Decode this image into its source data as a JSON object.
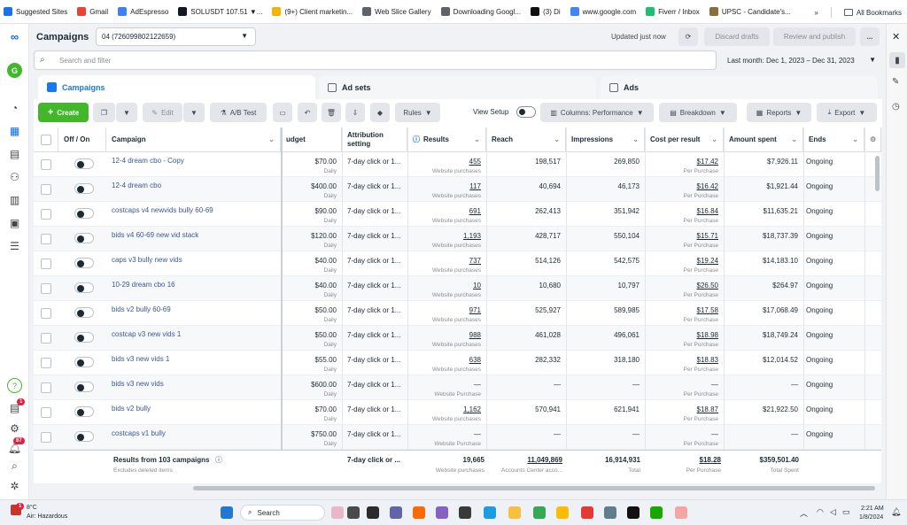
{
  "bookmarks": [
    {
      "label": "Suggested Sites",
      "icon": "ie-icon",
      "color": "#1a73e8"
    },
    {
      "label": "Gmail",
      "icon": "gmail-icon",
      "color": "#ea4335"
    },
    {
      "label": "AdEspresso",
      "icon": "adespresso-icon",
      "color": "#3b82f6"
    },
    {
      "label": "SOLUSDT 107.51 ▼...",
      "icon": "tradingview-icon",
      "color": "#131722"
    },
    {
      "label": "(9+) Client marketin...",
      "icon": "upwork-icon",
      "color": "#f4b400"
    },
    {
      "label": "Web Slice Gallery",
      "icon": "globe-icon",
      "color": "#5f6368"
    },
    {
      "label": "Downloading Googl...",
      "icon": "doc-icon",
      "color": "#5f6368"
    },
    {
      "label": "(3) Di",
      "icon": "fiverr-icon",
      "color": "#111111"
    },
    {
      "label": "www.google.com",
      "icon": "google-icon",
      "color": "#4285f4"
    },
    {
      "label": "Fiverr / Inbox",
      "icon": "fiverr-icon",
      "color": "#1dbf73"
    },
    {
      "label": "UPSC - Candidate's...",
      "icon": "upsc-icon",
      "color": "#8a6d3b"
    }
  ],
  "all_bookmarks": "All Bookmarks",
  "header": {
    "title": "Campaigns",
    "account": "04 (726099802122659)",
    "updated": "Updated just now",
    "discard": "Discard drafts",
    "review": "Review and publish",
    "more": "..."
  },
  "search": {
    "placeholder": "Search and filter"
  },
  "date_range": "Last month: Dec 1, 2023 – Dec 31, 2023",
  "tabs": {
    "campaigns": "Campaigns",
    "adsets": "Ad sets",
    "ads": "Ads"
  },
  "toolbar": {
    "create": "Create",
    "edit": "Edit",
    "ab_test": "A/B Test",
    "rules": "Rules",
    "view_setup": "View Setup",
    "columns": "Columns: Performance",
    "breakdown": "Breakdown",
    "reports": "Reports",
    "export": "Export"
  },
  "columns": {
    "offon": "Off / On",
    "campaign": "Campaign",
    "budget": "udget",
    "attribution": "Attribution setting",
    "results": "Results",
    "reach": "Reach",
    "impressions": "Impressions",
    "cpr": "Cost per result",
    "spent": "Amount spent",
    "ends": "Ends"
  },
  "rows": [
    {
      "name": "12-4 dream cbo - Copy",
      "budget": "$70.00",
      "budget_sub": "Daily",
      "attr": "7-day click or 1...",
      "results": "455",
      "results_sub": "Website purchases",
      "reach": "198,517",
      "impr": "269,850",
      "cpr": "$17.42",
      "cpr_sub": "Per Purchase",
      "spent": "$7,926.11",
      "ends": "Ongoing"
    },
    {
      "name": "12-4 dream cbo",
      "budget": "$400.00",
      "budget_sub": "Daily",
      "attr": "7-day click or 1...",
      "results": "117",
      "results_sub": "Website purchases",
      "reach": "40,694",
      "impr": "46,173",
      "cpr": "$16.42",
      "cpr_sub": "Per Purchase",
      "spent": "$1,921.44",
      "ends": "Ongoing"
    },
    {
      "name": "costcaps v4 newvids bully 60-69",
      "budget": "$90.00",
      "budget_sub": "Daily",
      "attr": "7-day click or 1...",
      "results": "691",
      "results_sub": "Website purchases",
      "reach": "262,413",
      "impr": "351,942",
      "cpr": "$16.84",
      "cpr_sub": "Per Purchase",
      "spent": "$11,635.21",
      "ends": "Ongoing"
    },
    {
      "name": "bids v4 60-69 new vid stack",
      "budget": "$120.00",
      "budget_sub": "Daily",
      "attr": "7-day click or 1...",
      "results": "1,193",
      "results_sub": "Website purchases",
      "reach": "428,717",
      "impr": "550,104",
      "cpr": "$15.71",
      "cpr_sub": "Per Purchase",
      "spent": "$18,737.39",
      "ends": "Ongoing"
    },
    {
      "name": "caps v3 bully new vids",
      "budget": "$40.00",
      "budget_sub": "Daily",
      "attr": "7-day click or 1...",
      "results": "737",
      "results_sub": "Website purchases",
      "reach": "514,126",
      "impr": "542,575",
      "cpr": "$19.24",
      "cpr_sub": "Per Purchase",
      "spent": "$14,183.10",
      "ends": "Ongoing"
    },
    {
      "name": "10-29 dream cbo 16",
      "budget": "$40.00",
      "budget_sub": "Daily",
      "attr": "7-day click or 1...",
      "results": "10",
      "results_sub": "Website purchases",
      "reach": "10,680",
      "impr": "10,797",
      "cpr": "$26.50",
      "cpr_sub": "Per Purchase",
      "spent": "$264.97",
      "ends": "Ongoing"
    },
    {
      "name": "bids v2 bully 60-69",
      "budget": "$50.00",
      "budget_sub": "Daily",
      "attr": "7-day click or 1...",
      "results": "971",
      "results_sub": "Website purchases",
      "reach": "525,927",
      "impr": "589,985",
      "cpr": "$17.58",
      "cpr_sub": "Per Purchase",
      "spent": "$17,068.49",
      "ends": "Ongoing"
    },
    {
      "name": "costcap v3 new vids 1",
      "budget": "$50.00",
      "budget_sub": "Daily",
      "attr": "7-day click or 1...",
      "results": "988",
      "results_sub": "Website purchases",
      "reach": "461,028",
      "impr": "496,061",
      "cpr": "$18.98",
      "cpr_sub": "Per Purchase",
      "spent": "$18,749.24",
      "ends": "Ongoing"
    },
    {
      "name": "bids v3 new vids 1",
      "budget": "$55.00",
      "budget_sub": "Daily",
      "attr": "7-day click or 1...",
      "results": "638",
      "results_sub": "Website purchases",
      "reach": "282,332",
      "impr": "318,180",
      "cpr": "$18.83",
      "cpr_sub": "Per Purchase",
      "spent": "$12,014.52",
      "ends": "Ongoing"
    },
    {
      "name": "bids v3 new vids",
      "budget": "$600.00",
      "budget_sub": "Daily",
      "attr": "7-day click or 1...",
      "results": "—",
      "results_sub": "Website Purchase",
      "reach": "—",
      "impr": "—",
      "cpr": "—",
      "cpr_sub": "Per Purchase",
      "spent": "—",
      "ends": "Ongoing"
    },
    {
      "name": "bids v2 bully",
      "budget": "$70.00",
      "budget_sub": "Daily",
      "attr": "7-day click or 1...",
      "results": "1,162",
      "results_sub": "Website purchases",
      "reach": "570,941",
      "impr": "621,941",
      "cpr": "$18.87",
      "cpr_sub": "Per Purchase",
      "spent": "$21,922.50",
      "ends": "Ongoing"
    },
    {
      "name": "costcaps v1 bully",
      "budget": "$750.00",
      "budget_sub": "Daily",
      "attr": "7-day click or 1...",
      "results": "—",
      "results_sub": "Website Purchase",
      "reach": "—",
      "impr": "—",
      "cpr": "—",
      "cpr_sub": "Per Purchase",
      "spent": "—",
      "ends": "Ongoing"
    }
  ],
  "footer": {
    "label": "Results from 103 campaigns",
    "sublabel": "Excludes deleted items",
    "attr": "7-day click or ...",
    "results": "19,665",
    "results_sub": "Website purchases",
    "reach": "11,049,869",
    "reach_sub": "Accounts Center acco...",
    "impr": "16,914,931",
    "impr_sub": "Total",
    "cpr": "$18.28",
    "cpr_sub": "Per Purchase",
    "spent": "$359,501.40",
    "spent_sub": "Total Spent"
  },
  "rail_badges": {
    "notifications": "1",
    "alerts": "87"
  },
  "taskbar": {
    "weather_temp": "8°C",
    "weather_desc": "Air: Hazardous",
    "weather_badge": "1",
    "search": "Search",
    "time": "2:21 AM",
    "date": "1/8/2024"
  },
  "colors": {
    "accent": "#1877f2",
    "create": "#42b72a",
    "link": "#385898"
  }
}
